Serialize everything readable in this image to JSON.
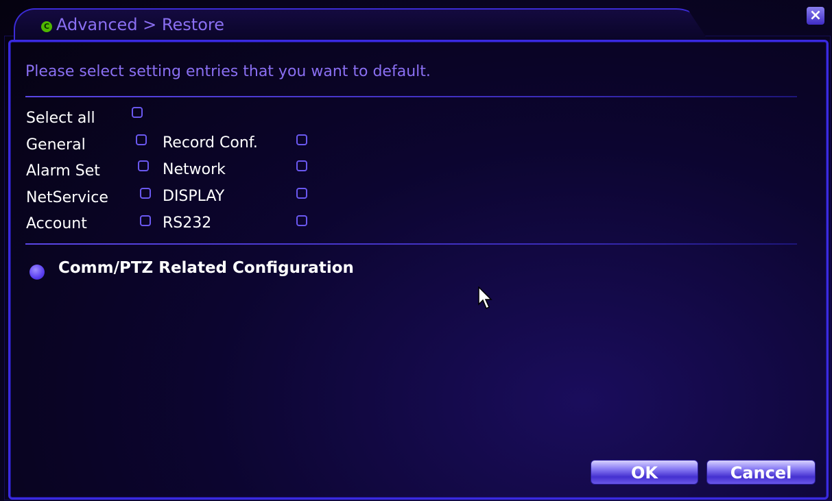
{
  "window": {
    "title": "Advanced > Restore",
    "title_icon": "C",
    "close_label": "×"
  },
  "header": {
    "instruction": "Please select setting entries that you want to default."
  },
  "options": {
    "select_all": "Select all",
    "left": [
      "General",
      "Alarm Set",
      "NetService",
      "Account"
    ],
    "right": [
      "Record Conf.",
      "Network",
      "DISPLAY",
      "RS232"
    ]
  },
  "radio": {
    "label": "Comm/PTZ Related Configuration"
  },
  "buttons": {
    "ok": "OK",
    "cancel": "Cancel"
  },
  "colors": {
    "accent": "#3a2ae0",
    "title_text": "#8a6ff2",
    "label_text": "#ffffff",
    "background": "#0c0530"
  }
}
